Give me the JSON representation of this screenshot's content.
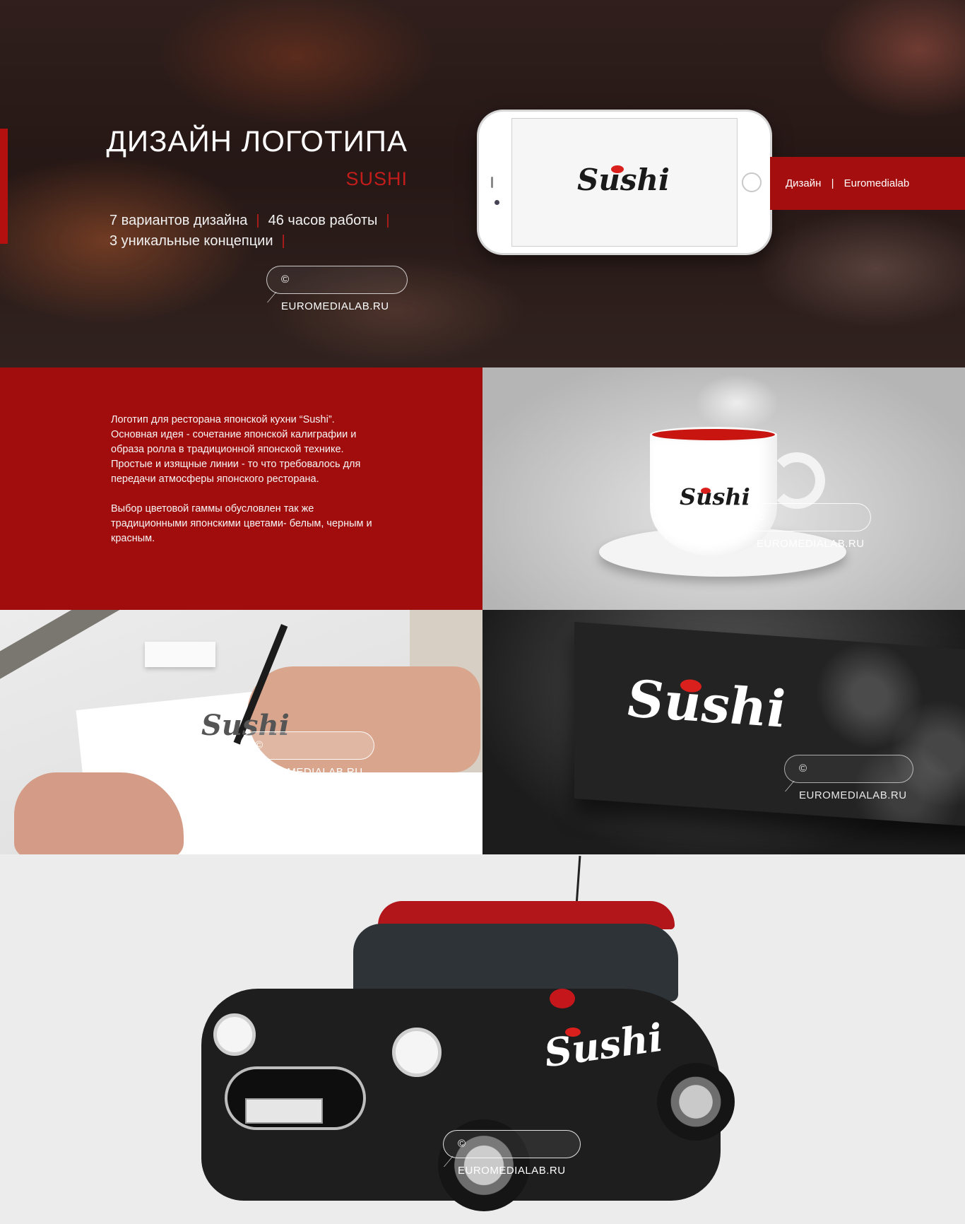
{
  "hero": {
    "title": "ДИЗАЙН ЛОГОТИПА",
    "subtitle": "SUSHI",
    "stats": {
      "variants": "7 вариантов дизайна",
      "hours": "46 часов работы",
      "concepts": "3 уникальные концепции",
      "separator": "|"
    },
    "copyright": "© EUROMEDIALAB.RU",
    "tags": {
      "category": "Дизайн",
      "separator": "|",
      "author": "Euromedialab"
    }
  },
  "logo": {
    "text": "Sushi",
    "ink_color": "#1a1a1a",
    "accent_color": "#d9201c"
  },
  "description": {
    "paragraph_1": "Логотип для ресторана японской кухни “Sushi”. Основная идея - сочетание японской калиграфии и образа ролла в традиционной японской технике. Простые и изящные линии - то что требовалось для передачи атмосферы японского ресторана.",
    "paragraph_2": "Выбор цветовой гаммы обусловлен так же традиционными японскими цветами- белым, черным и красным."
  },
  "gallery": {
    "cup_watermark": "© EUROMEDIALAB.RU",
    "sketch_watermark": "© EUROMEDIALAB.RU",
    "card_watermark": "© EUROMEDIALAB.RU",
    "car_watermark": "© EUROMEDIALAB.RU"
  },
  "colors": {
    "brand_red": "#a50e0e",
    "accent_red": "#c21d1b",
    "white": "#ffffff",
    "black": "#1e1e1e"
  }
}
